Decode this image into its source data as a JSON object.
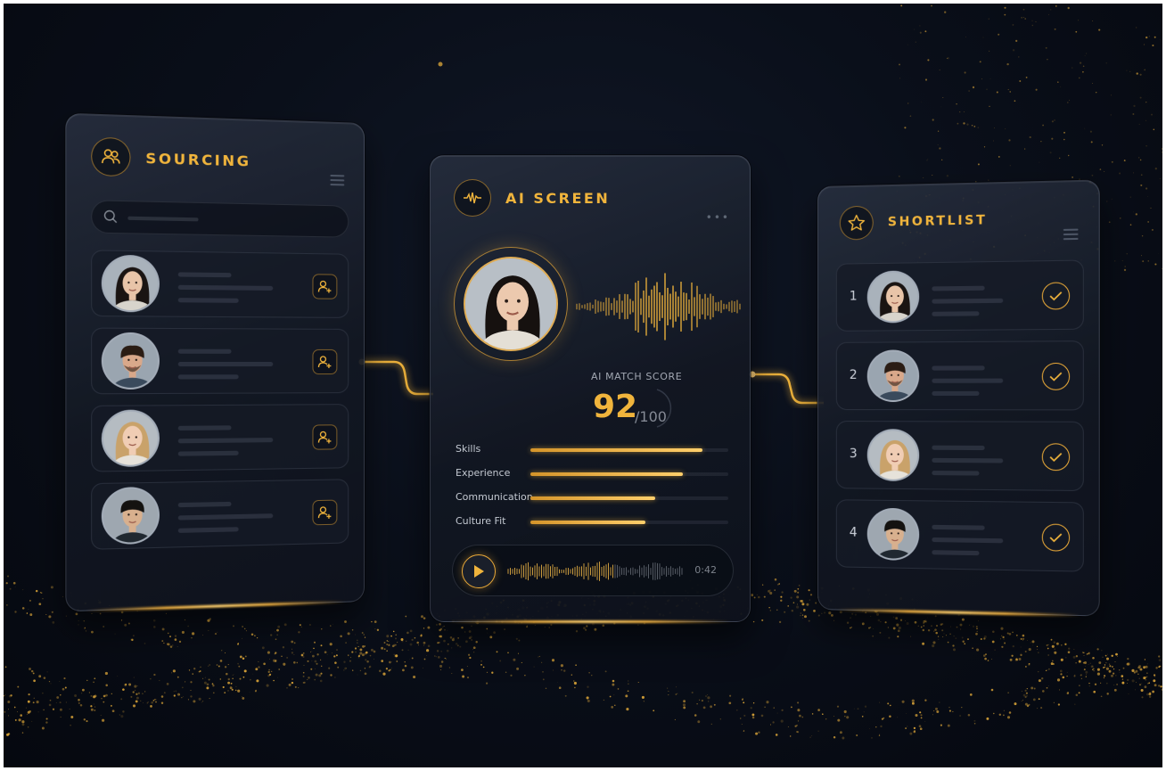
{
  "colors": {
    "accent": "#f0b43c",
    "background": "#0a0f1a",
    "panel": "#141a26"
  },
  "sourcing": {
    "title": "SOURCING",
    "icon": "users-icon",
    "candidates": [
      {
        "avatar": "woman-asian-avatar"
      },
      {
        "avatar": "man-beard-avatar"
      },
      {
        "avatar": "woman-blonde-avatar"
      },
      {
        "avatar": "man-asian-avatar"
      }
    ]
  },
  "screen": {
    "title": "AI SCREEN",
    "icon": "waveform-icon",
    "score_label": "AI MATCH SCORE",
    "score_value": "92",
    "score_max": "/100",
    "metrics": [
      {
        "label": "Skills",
        "value": 0.87
      },
      {
        "label": "Experience",
        "value": 0.77
      },
      {
        "label": "Communication",
        "value": 0.63
      },
      {
        "label": "Culture Fit",
        "value": 0.58
      }
    ],
    "audio_time": "0:42"
  },
  "shortlist": {
    "title": "SHORTLIST",
    "icon": "star-icon",
    "entries": [
      {
        "rank": "1"
      },
      {
        "rank": "2"
      },
      {
        "rank": "3"
      },
      {
        "rank": "4"
      }
    ]
  }
}
